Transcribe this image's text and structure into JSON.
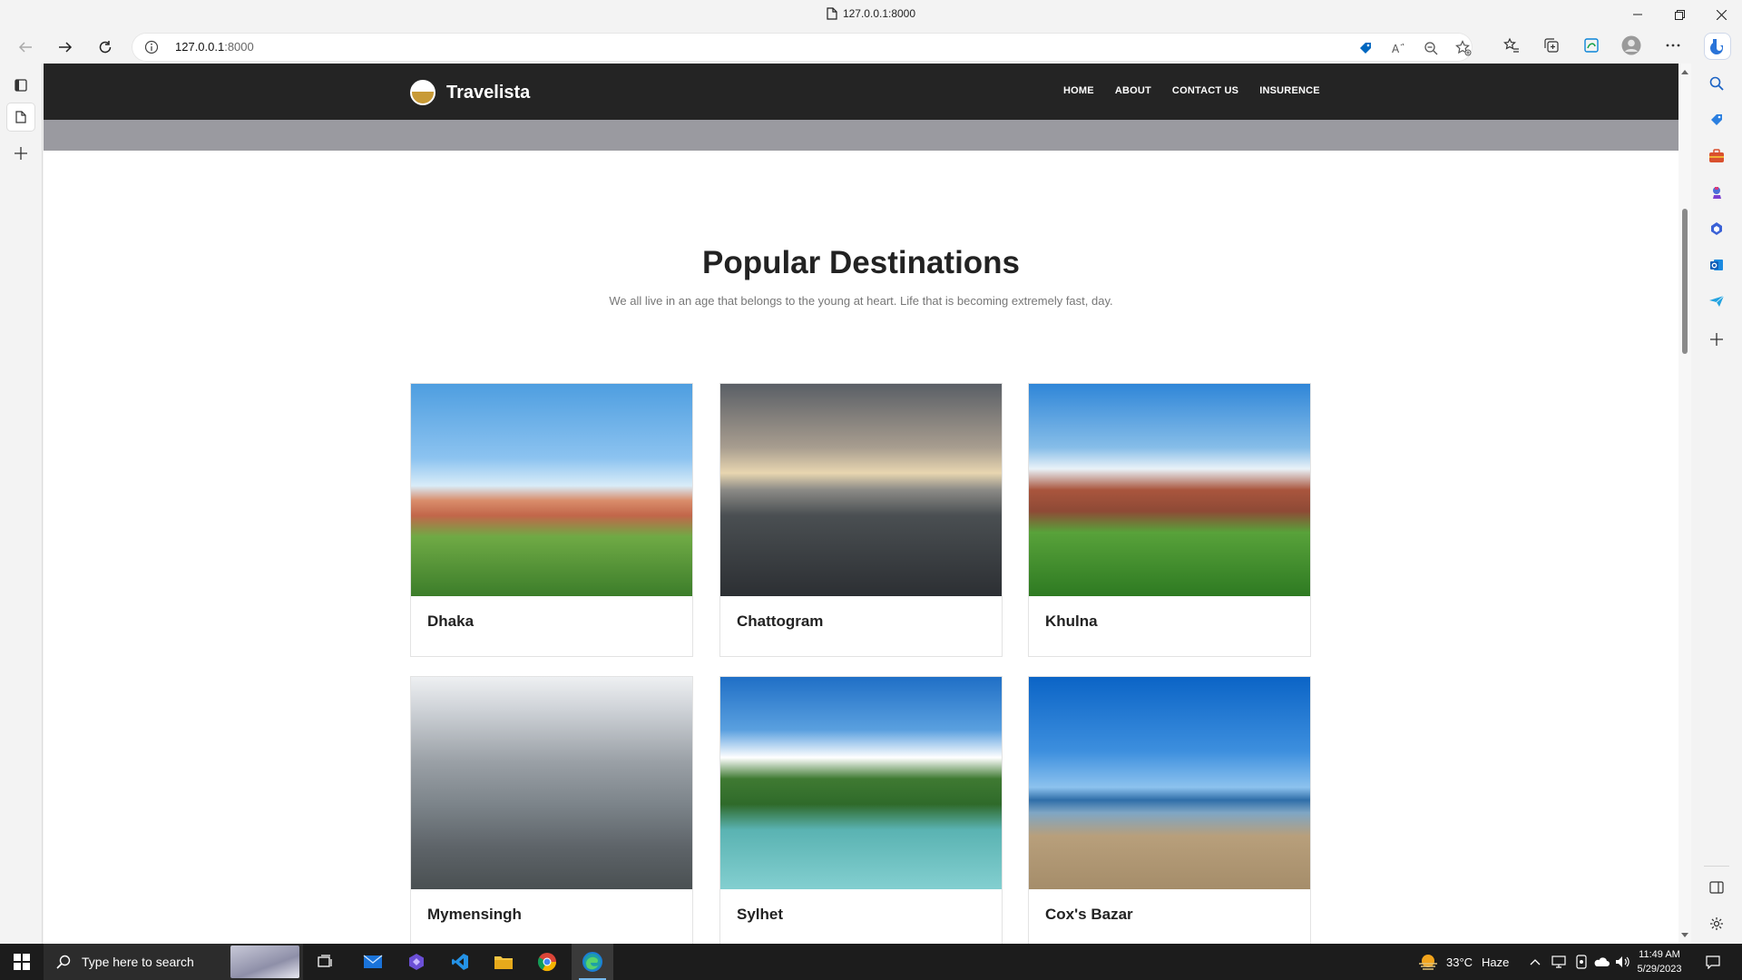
{
  "window": {
    "title": "127.0.0.1:8000"
  },
  "address_bar": {
    "url_host": "127.0.0.1",
    "url_port": ":8000"
  },
  "site": {
    "brand": "Travelista",
    "menu": [
      "HOME",
      "ABOUT",
      "CONTACT US",
      "INSURENCE"
    ]
  },
  "section": {
    "title": "Popular Destinations",
    "subtitle": "We all live in an age that belongs to the young at heart. Life that is becoming extremely fast, day."
  },
  "destinations": [
    {
      "name": "Dhaka"
    },
    {
      "name": "Chattogram"
    },
    {
      "name": "Khulna"
    },
    {
      "name": "Mymensingh"
    },
    {
      "name": "Sylhet"
    },
    {
      "name": "Cox's Bazar"
    }
  ],
  "taskbar": {
    "search_placeholder": "Type here to search",
    "weather_temp": "33°C",
    "weather_desc": "Haze",
    "time": "11:49 AM",
    "date": "5/29/2023"
  },
  "colors": {
    "nav_bg": "#242424",
    "banner_strip": "#9a9aa0",
    "accent": "#0067c0"
  }
}
